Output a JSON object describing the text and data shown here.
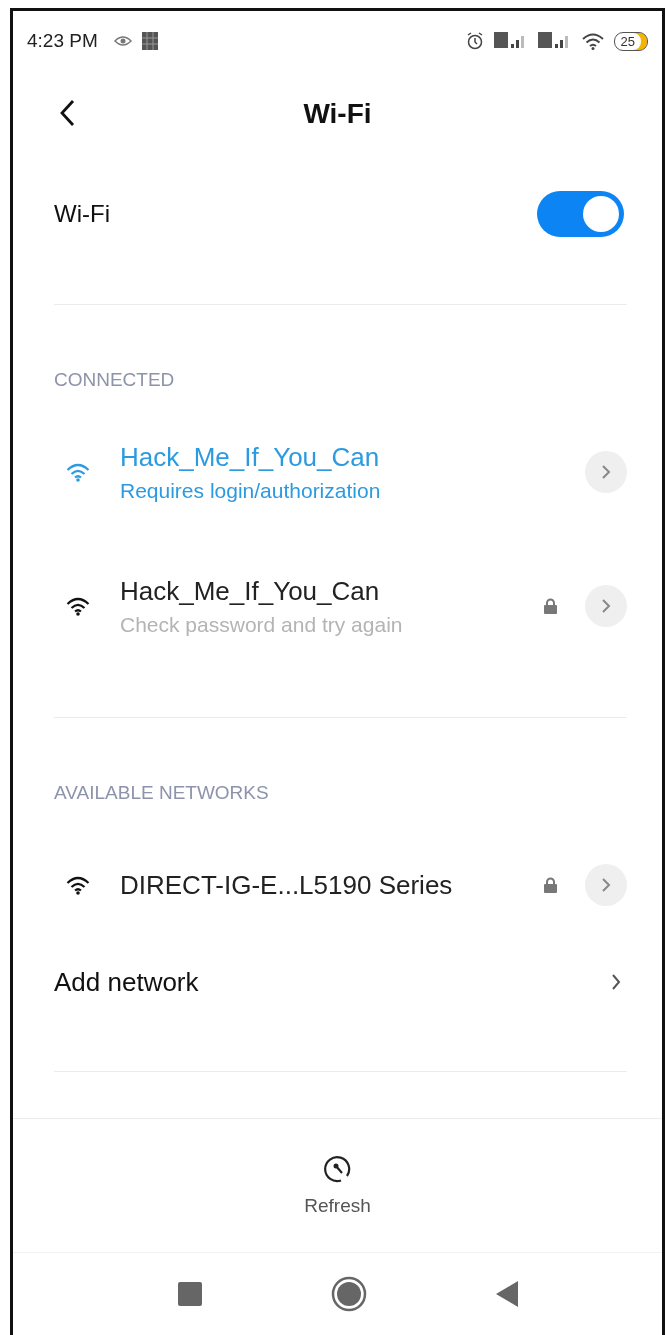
{
  "status_bar": {
    "time": "4:23 PM",
    "battery": "25"
  },
  "header": {
    "title": "Wi-Fi"
  },
  "wifi_toggle": {
    "label": "Wi-Fi",
    "on": true
  },
  "sections": [
    {
      "title": "CONNECTED",
      "networks": [
        {
          "name": "Hack_Me_If_You_Can",
          "status": "Requires login/authorization",
          "selected": true,
          "locked": false
        },
        {
          "name": "Hack_Me_If_You_Can",
          "status": "Check password and try again",
          "selected": false,
          "locked": true
        }
      ]
    },
    {
      "title": "AVAILABLE NETWORKS",
      "networks": [
        {
          "name": "DIRECT-IG-E...L5190 Series",
          "selected": false,
          "locked": true
        }
      ]
    }
  ],
  "add_network": {
    "label": "Add network"
  },
  "refresh": {
    "label": "Refresh"
  }
}
